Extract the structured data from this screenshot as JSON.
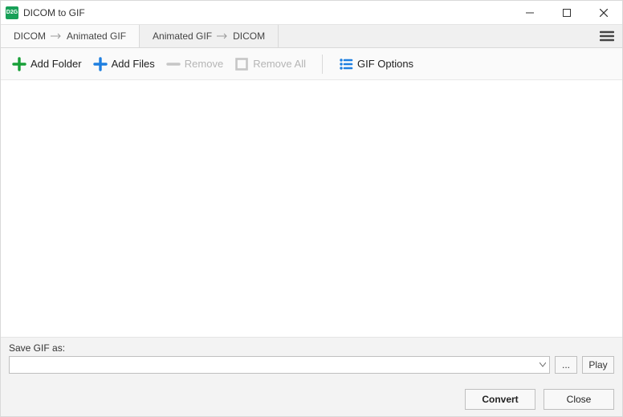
{
  "window": {
    "title": "DICOM to GIF",
    "app_icon_text": "D2G"
  },
  "tabs": {
    "tab1_left": "DICOM",
    "tab1_right": "Animated GIF",
    "tab2_left": "Animated GIF",
    "tab2_right": "DICOM"
  },
  "toolbar": {
    "add_folder": "Add Folder",
    "add_files": "Add Files",
    "remove": "Remove",
    "remove_all": "Remove All",
    "gif_options": "GIF Options"
  },
  "bottom": {
    "save_label": "Save GIF as:",
    "path_value": "",
    "browse": "...",
    "play": "Play",
    "convert": "Convert",
    "close": "Close"
  }
}
